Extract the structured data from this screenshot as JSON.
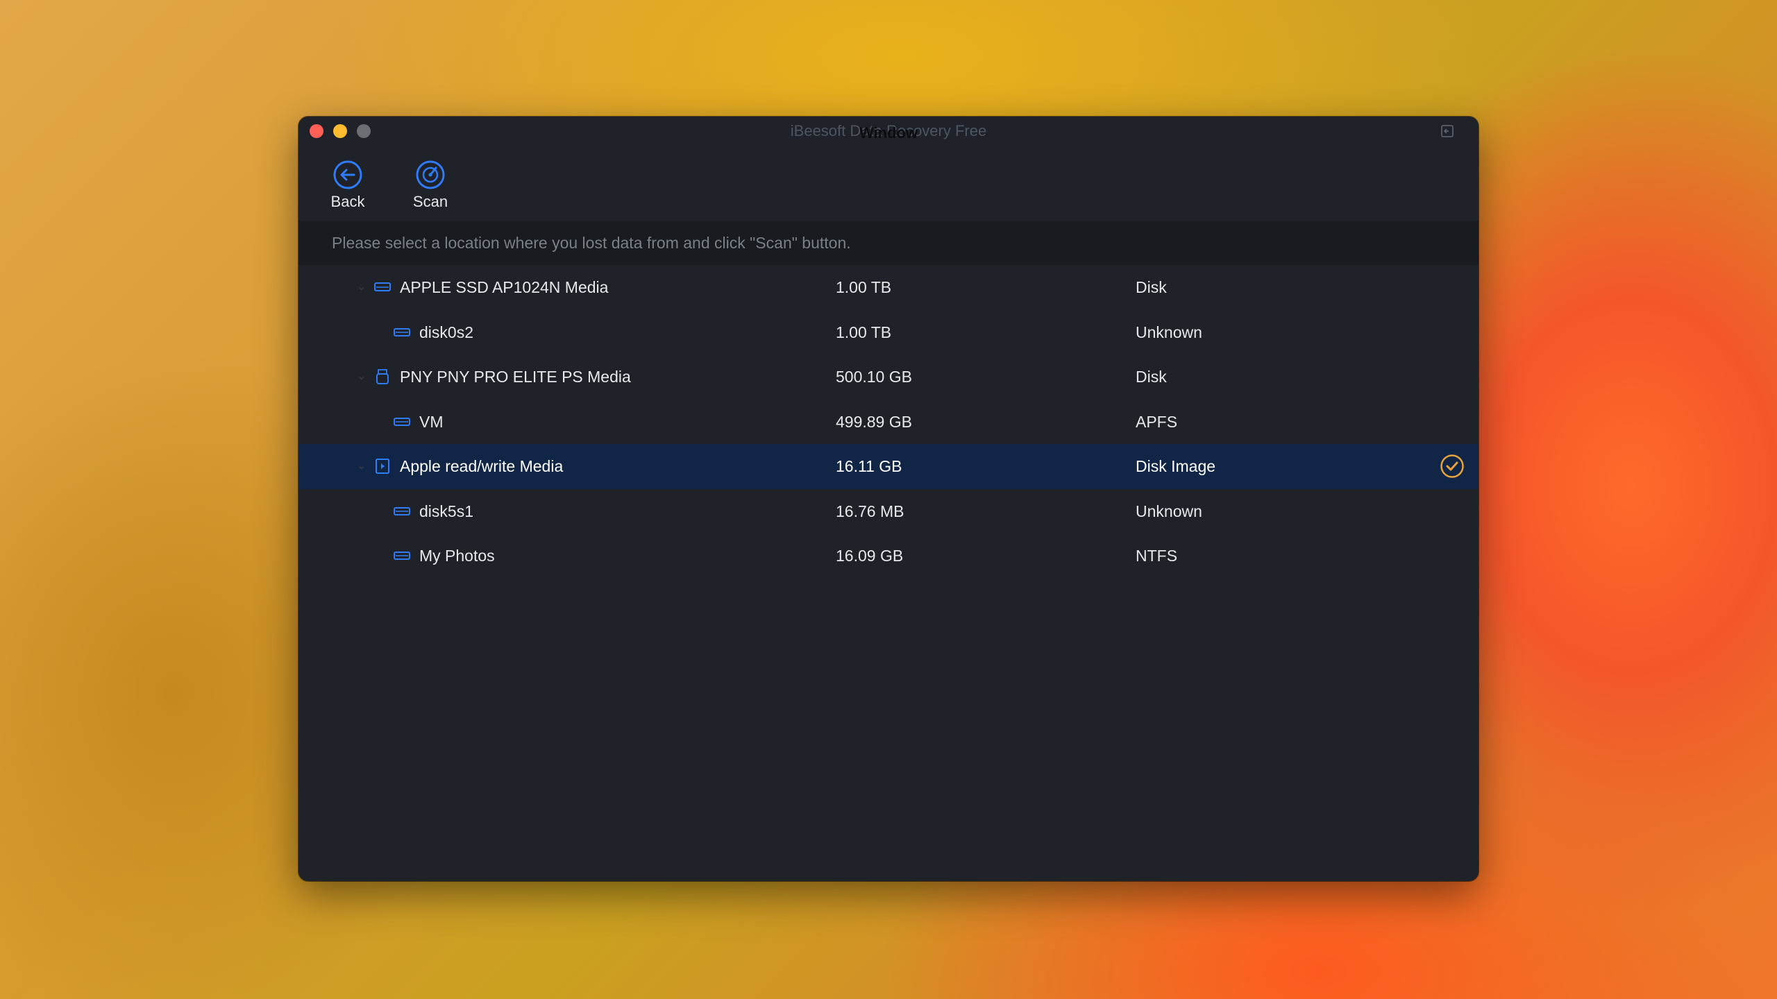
{
  "window": {
    "title": "iBeesoft Data Recovery Free",
    "overlay_label": "Window"
  },
  "toolbar": {
    "back_label": "Back",
    "scan_label": "Scan"
  },
  "instruction": "Please select a location where you lost data from and click \"Scan\" button.",
  "colors": {
    "accent": "#2f7cf6",
    "selected_row": "#112647",
    "check": "#e8a43a"
  },
  "rows": [
    {
      "name": "APPLE SSD AP1024N Media",
      "size": "1.00 TB",
      "type": "Disk",
      "level": 0,
      "icon": "hard-drive-icon",
      "expandable": true,
      "selected": false
    },
    {
      "name": "disk0s2",
      "size": "1.00 TB",
      "type": "Unknown",
      "level": 1,
      "icon": "partition-icon",
      "expandable": false,
      "selected": false
    },
    {
      "name": "PNY PNY PRO ELITE PS Media",
      "size": "500.10 GB",
      "type": "Disk",
      "level": 0,
      "icon": "usb-drive-icon",
      "expandable": true,
      "selected": false
    },
    {
      "name": "VM",
      "size": "499.89 GB",
      "type": "APFS",
      "level": 1,
      "icon": "partition-icon",
      "expandable": false,
      "selected": false
    },
    {
      "name": "Apple read/write Media",
      "size": "16.11 GB",
      "type": "Disk Image",
      "level": 0,
      "icon": "disk-image-icon",
      "expandable": true,
      "selected": true
    },
    {
      "name": "disk5s1",
      "size": "16.76 MB",
      "type": "Unknown",
      "level": 1,
      "icon": "partition-icon",
      "expandable": false,
      "selected": false
    },
    {
      "name": "My Photos",
      "size": "16.09 GB",
      "type": "NTFS",
      "level": 1,
      "icon": "partition-icon",
      "expandable": false,
      "selected": false
    }
  ]
}
